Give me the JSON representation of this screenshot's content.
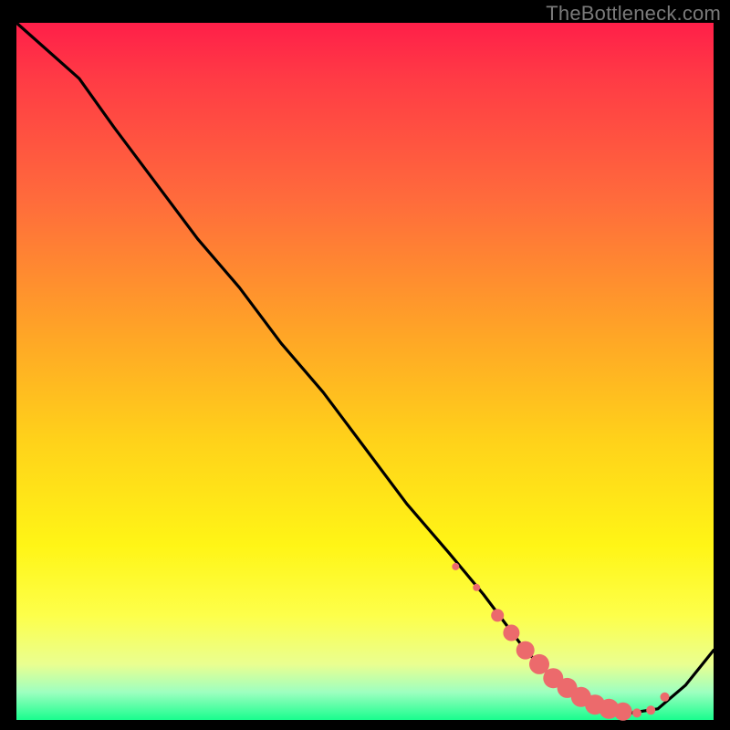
{
  "attribution": "TheBottleneck.com",
  "colors": {
    "background": "#000000",
    "gradient_top": "#ff1f49",
    "gradient_bottom": "#19fd8e",
    "curve": "#000000",
    "marker": "#ec6a6c"
  },
  "chart_data": {
    "type": "line",
    "title": "",
    "xlabel": "",
    "ylabel": "",
    "xlim": [
      0,
      100
    ],
    "ylim": [
      0,
      100
    ],
    "x": [
      0,
      9,
      14,
      20,
      26,
      32,
      38,
      44,
      50,
      56,
      62,
      67,
      70,
      73,
      76,
      79,
      82,
      85,
      88,
      92,
      96,
      100
    ],
    "values": [
      100,
      92,
      85,
      77,
      69,
      62,
      54,
      47,
      39,
      31,
      24,
      18,
      14,
      10,
      7,
      4.6,
      2.8,
      1.6,
      1.0,
      1.6,
      5.0,
      10
    ],
    "markers_x": [
      63,
      66,
      69,
      71,
      73,
      75,
      77,
      79,
      81,
      83,
      85,
      87,
      89,
      91,
      93
    ],
    "markers_y": [
      22,
      19,
      15,
      12.5,
      10,
      8,
      6,
      4.6,
      3.3,
      2.2,
      1.6,
      1.2,
      1.0,
      1.4,
      3.3
    ],
    "marker_sizes": [
      4,
      4,
      7,
      9,
      10,
      11,
      11,
      11,
      11,
      11,
      11,
      10,
      5,
      5,
      5
    ]
  }
}
